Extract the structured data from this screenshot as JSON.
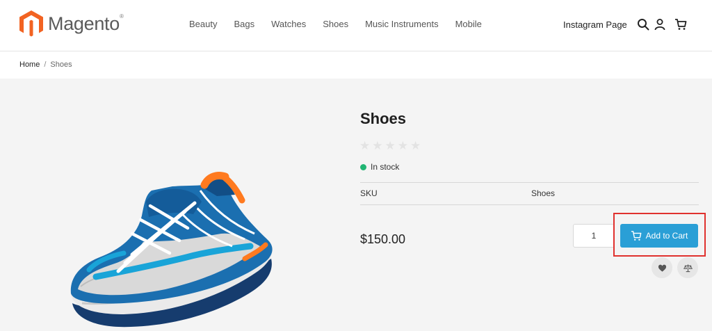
{
  "header": {
    "logo_text": "Magento",
    "logo_reg": "®",
    "nav": [
      "Beauty",
      "Bags",
      "Watches",
      "Shoes",
      "Music Instruments",
      "Mobile"
    ],
    "instagram": "Instagram Page",
    "icons": [
      "search-icon",
      "user-icon",
      "cart-icon"
    ]
  },
  "breadcrumb": {
    "home": "Home",
    "separator": "/",
    "current": "Shoes"
  },
  "product": {
    "title": "Shoes",
    "rating_stars": 0,
    "stock": "In stock",
    "sku_label": "SKU",
    "sku_value": "Shoes",
    "price": "$150.00",
    "qty": "1",
    "add_to_cart": "Add to Cart",
    "actions": [
      "wishlist-heart-icon",
      "compare-scale-icon"
    ]
  },
  "colors": {
    "brand_orange": "#f26322",
    "button_blue": "#2a9fd6",
    "stock_green": "#21b573",
    "highlight_red": "#e0312e"
  }
}
